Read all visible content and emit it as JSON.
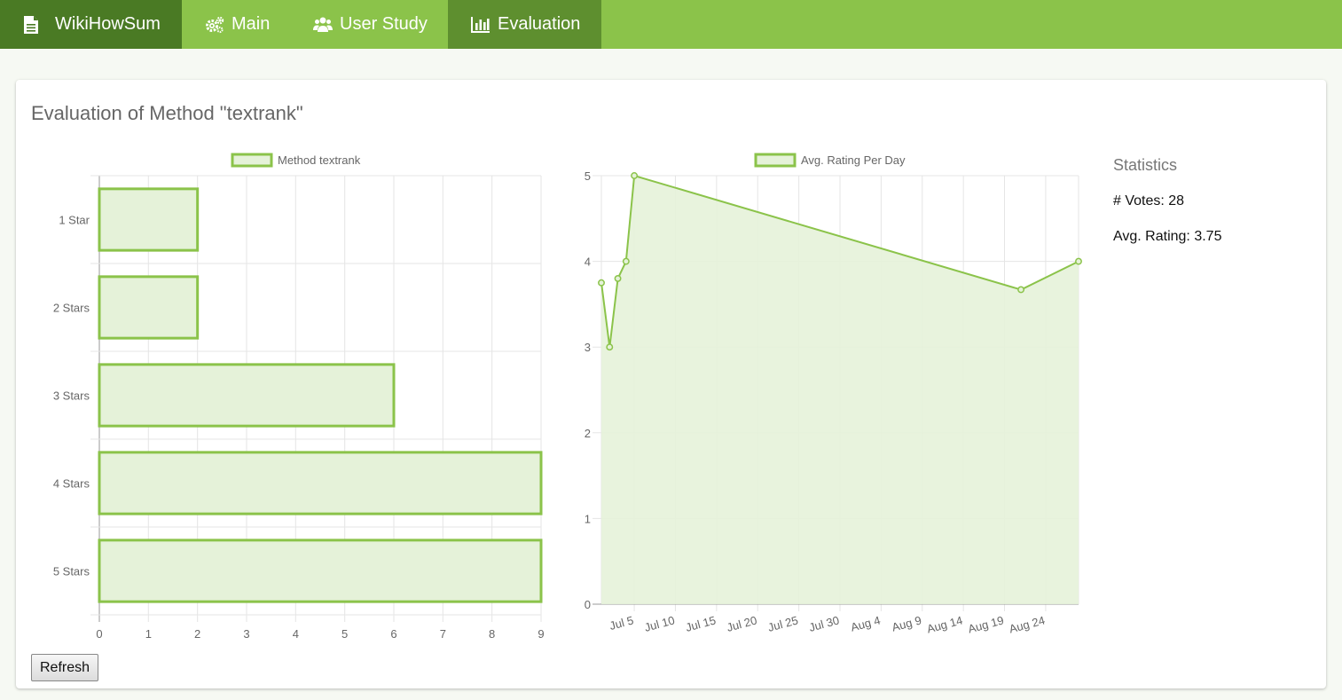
{
  "nav": {
    "brand": "WikiHowSum",
    "items": [
      {
        "label": "Main",
        "icon": "cogs-icon"
      },
      {
        "label": "User Study",
        "icon": "users-icon"
      },
      {
        "label": "Evaluation",
        "icon": "bar-chart-icon",
        "active": true
      }
    ]
  },
  "colors": {
    "navbar": "#8bc34a",
    "brand_bg": "#4a7a24",
    "active_tab": "#5e8f2f",
    "series_stroke": "#8bc34a",
    "series_fill": "#e5f2d9"
  },
  "page": {
    "title": "Evaluation of Method \"textrank\""
  },
  "stats": {
    "title": "Statistics",
    "votes_label": "# Votes:",
    "votes": "28",
    "rating_label": "Avg. Rating:",
    "rating": "3.75"
  },
  "refresh_label": "Refresh",
  "chart_data": [
    {
      "type": "bar",
      "orientation": "horizontal",
      "categories": [
        "1 Star",
        "2 Stars",
        "3 Stars",
        "4 Stars",
        "5 Stars"
      ],
      "series": [
        {
          "name": "Method textrank",
          "values": [
            2,
            2,
            6,
            9,
            9
          ]
        }
      ],
      "xlim": [
        0,
        9
      ],
      "x_ticks": [
        "0",
        "1",
        "2",
        "3",
        "4",
        "5",
        "6",
        "7",
        "8",
        "9"
      ],
      "legend": "top-center",
      "grid": true
    },
    {
      "type": "area",
      "series": [
        {
          "name": "Avg. Rating Per Day",
          "points": [
            {
              "x": "2017-07-01",
              "y": 3.75
            },
            {
              "x": "2017-07-02",
              "y": 3.0
            },
            {
              "x": "2017-07-03",
              "y": 3.8
            },
            {
              "x": "2017-07-04",
              "y": 4.0
            },
            {
              "x": "2017-07-05",
              "y": 5.0
            },
            {
              "x": "2017-08-21",
              "y": 3.67
            },
            {
              "x": "2017-08-28",
              "y": 4.0
            }
          ]
        }
      ],
      "ylim": [
        0,
        5
      ],
      "y_ticks": [
        "0",
        "1",
        "2",
        "3",
        "4",
        "5"
      ],
      "x_ticks": [
        "Jul 5",
        "Jul 10",
        "Jul 15",
        "Jul 20",
        "Jul 25",
        "Jul 30",
        "Aug 4",
        "Aug 9",
        "Aug 14",
        "Aug 19",
        "Aug 24"
      ],
      "legend": "top-center",
      "grid": true
    }
  ]
}
